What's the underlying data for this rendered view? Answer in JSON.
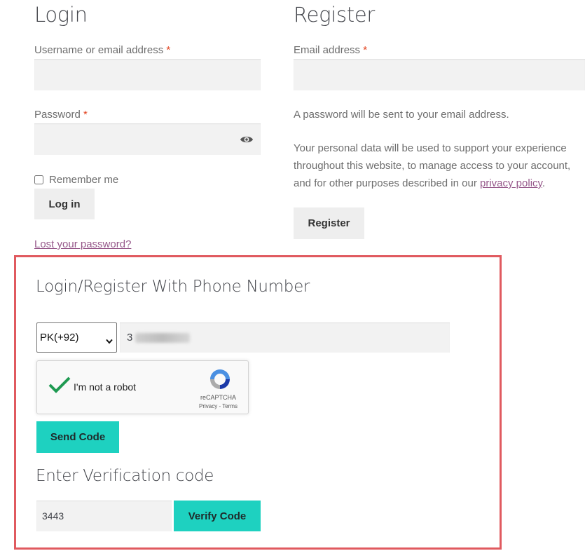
{
  "login": {
    "title": "Login",
    "username_label": "Username or email address",
    "required_mark": "*",
    "password_label": "Password",
    "remember_label": "Remember me",
    "login_button": "Log in",
    "lost_password_link": "Lost your password?"
  },
  "register": {
    "title": "Register",
    "email_label": "Email address",
    "required_mark": "*",
    "password_note": "A password will be sent to your email address.",
    "privacy_text_before": "Your personal data will be used to support your experience throughout this website, to manage access to your account, and for other purposes described in our ",
    "privacy_link": "privacy policy",
    "privacy_text_after": ".",
    "register_button": "Register"
  },
  "phone_login": {
    "title": "Login/Register With Phone Number",
    "country_code": "PK(+92)",
    "phone_value": "3",
    "recaptcha": {
      "label": "I'm not a robot",
      "brand": "reCAPTCHA",
      "privacy": "Privacy",
      "separator": " - ",
      "terms": "Terms",
      "checked": true
    },
    "send_code_button": "Send Code",
    "verification_title": "Enter Verification code",
    "verification_value": "3443",
    "verify_button": "Verify Code"
  },
  "colors": {
    "accent_teal": "#1ed1c0",
    "highlight_border": "#e05a5f",
    "link": "#96588a",
    "required": "#e2401c"
  },
  "icons": {
    "password_toggle": "eye-icon",
    "recaptcha_check": "check-icon",
    "recaptcha_logo": "recaptcha-logo-icon",
    "select_arrow": "chevron-down-icon"
  }
}
